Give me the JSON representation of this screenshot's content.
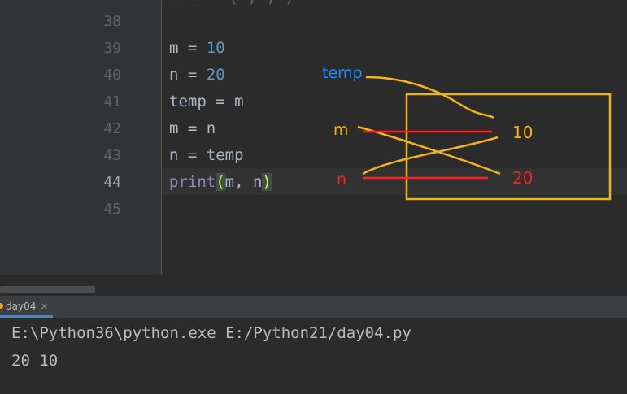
{
  "editor": {
    "partial_top_line": "_  _ _  _  (  ,  ,  )",
    "lines": [
      {
        "number": "38",
        "code": ""
      },
      {
        "number": "39",
        "code": "m = 10"
      },
      {
        "number": "40",
        "code": "n = 20"
      },
      {
        "number": "41",
        "code": "temp = m"
      },
      {
        "number": "42",
        "code": "m = n"
      },
      {
        "number": "43",
        "code": "n = temp"
      },
      {
        "number": "44",
        "code": "print(m, n)"
      },
      {
        "number": "45",
        "code": ""
      }
    ],
    "current_line": "44"
  },
  "annotation": {
    "label_temp": "temp",
    "label_m": "m",
    "label_n": "n",
    "value_top": "10",
    "value_bottom": "20",
    "colors": {
      "temp": "#1e8fff",
      "m": "#ffb000",
      "n": "#ff2020",
      "value_top": "#ffb000",
      "value_bottom": "#ff2020",
      "box": "#f2b21a",
      "arrows": "#f4b41a"
    }
  },
  "run_panel": {
    "tab_label": "day04",
    "close_symbol": "×"
  },
  "console": {
    "command": "E:\\Python36\\python.exe E:/Python21/day04.py",
    "output": "20 10"
  }
}
